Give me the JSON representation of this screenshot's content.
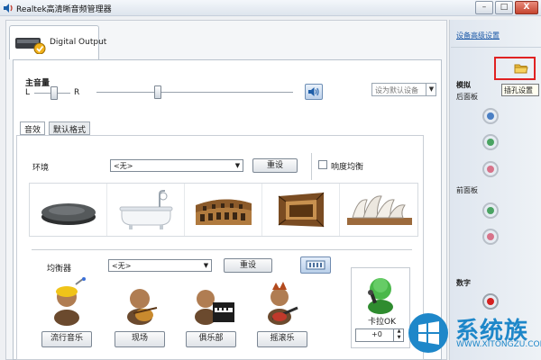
{
  "window": {
    "title": "Realtek高清晰音频管理器",
    "controls": [
      "–",
      "□",
      "X"
    ]
  },
  "device_tab": {
    "label": "Digital Output"
  },
  "main_volume": {
    "label": "主音量",
    "left": "L",
    "right": "R",
    "balance": 0.5,
    "level": 0.32
  },
  "default_device": {
    "label": "设为默认设备"
  },
  "sub_tabs": [
    {
      "label": "音效"
    },
    {
      "label": "默认格式"
    }
  ],
  "environment": {
    "label": "环境",
    "selected": "<无>",
    "reset_label": "重设",
    "loudness_label": "响度均衡",
    "loudness_checked": false,
    "presets": [
      "stone",
      "bathtub",
      "colosseum",
      "wooden-room",
      "opera-house"
    ]
  },
  "equalizer": {
    "label": "均衡器",
    "selected": "<无>",
    "reset_label": "重设",
    "presets": [
      {
        "label": "流行音乐"
      },
      {
        "label": "现场"
      },
      {
        "label": "俱乐部"
      },
      {
        "label": "摇滚乐"
      }
    ]
  },
  "karaoke": {
    "label": "卡拉OK",
    "value": "+0"
  },
  "right_panel": {
    "advanced_link": "设备高级设置",
    "analog_label": "模拟",
    "back_panel_label": "后面板",
    "front_panel_label": "前面板",
    "digital_label": "数字",
    "tooltip": "插孔设置",
    "back_jacks": [
      "#4a7fc4",
      "#4aa362",
      "#d7738a"
    ],
    "front_jacks": [
      "#4aa362",
      "#d7738a"
    ],
    "digital_jack": "#d42020"
  },
  "watermark": {
    "title": "系统族",
    "url": "WWW.XITONGZU.COM"
  }
}
